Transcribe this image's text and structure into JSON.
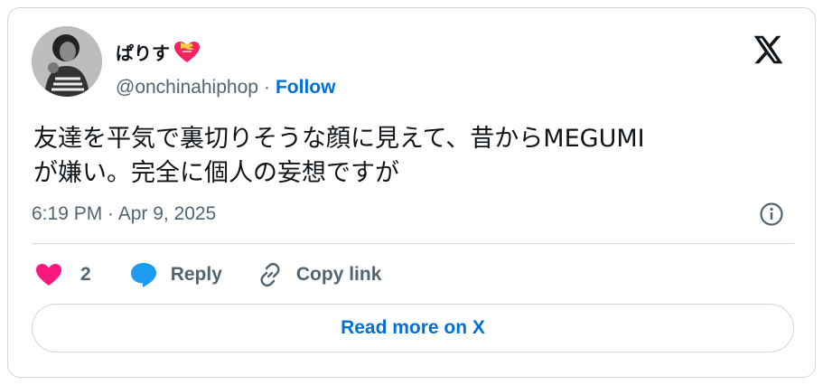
{
  "user": {
    "display_name": "ぱりす",
    "handle": "@onchinahiphop",
    "separator": "·",
    "follow_label": "Follow"
  },
  "tweet": {
    "text_line1": "友達を平気で裏切りそうな顔に見えて、昔からMEGUMI",
    "text_line2": "が嫌い。完全に個人の妄想ですが",
    "timestamp": "6:19 PM · Apr 9, 2025"
  },
  "actions": {
    "like_count": "2",
    "reply_label": "Reply",
    "copy_link_label": "Copy link"
  },
  "read_more_label": "Read more on X",
  "colors": {
    "like": "#f91880",
    "reply": "#1d9bf0",
    "link": "#006fd6",
    "muted": "#536471",
    "border": "#cfd9de"
  },
  "icons": [
    "x-logo-icon",
    "heart-emoji-icon",
    "like-heart-icon",
    "reply-bubble-icon",
    "link-icon",
    "info-icon"
  ]
}
